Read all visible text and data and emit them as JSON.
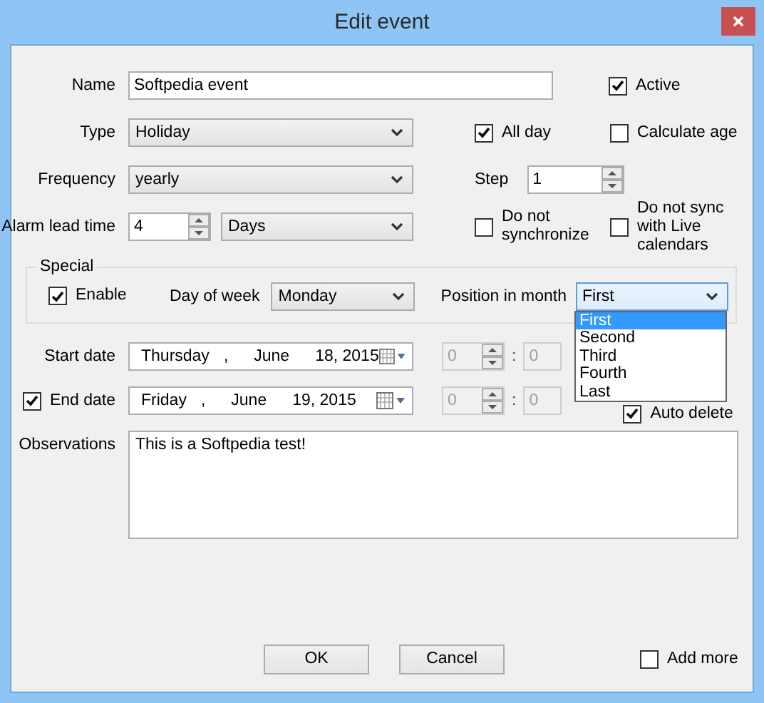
{
  "window": {
    "title": "Edit event"
  },
  "name": {
    "label": "Name",
    "value": "Softpedia event"
  },
  "active": {
    "label": "Active",
    "checked": true
  },
  "type": {
    "label": "Type",
    "value": "Holiday"
  },
  "all_day": {
    "label": "All day",
    "checked": true
  },
  "calculate_age": {
    "label": "Calculate age",
    "checked": false
  },
  "frequency": {
    "label": "Frequency",
    "value": "yearly"
  },
  "step": {
    "label": "Step",
    "value": "1"
  },
  "alarm_lead_time": {
    "label": "Alarm lead time",
    "value": "4",
    "unit": "Days"
  },
  "do_not_synchronize": {
    "label": "Do not synchronize",
    "checked": false
  },
  "do_not_sync_live": {
    "label": "Do not sync with Live calendars",
    "checked": false
  },
  "special": {
    "title": "Special",
    "enable": {
      "label": "Enable",
      "checked": true
    },
    "day_of_week": {
      "label": "Day of week",
      "value": "Monday"
    },
    "position_in_month": {
      "label": "Position in month",
      "value": "First",
      "expanded": true,
      "options": [
        {
          "label": "First",
          "selected": true
        },
        {
          "label": "Second",
          "selected": false
        },
        {
          "label": "Third",
          "selected": false
        },
        {
          "label": "Fourth",
          "selected": false
        },
        {
          "label": "Last",
          "selected": false
        }
      ]
    }
  },
  "start_date": {
    "label": "Start date",
    "weekday": "Thursday",
    "separator": ",",
    "month": "June",
    "day_year": "18, 2015",
    "hour": "0",
    "time_separator": ":",
    "minute": "0",
    "time_disabled": true
  },
  "end_date": {
    "label": "End date",
    "checked": true,
    "weekday": "Friday",
    "separator": ",",
    "month": "June",
    "day_year": "19, 2015",
    "hour": "0",
    "time_separator": ":",
    "minute": "0",
    "time_disabled": true
  },
  "auto_delete": {
    "label": "Auto delete",
    "checked": true
  },
  "observations": {
    "label": "Observations",
    "value": "This is a Softpedia test!"
  },
  "buttons": [
    {
      "label": "OK"
    },
    {
      "label": "Cancel"
    }
  ],
  "add_more": {
    "label": "Add more",
    "checked": false
  }
}
